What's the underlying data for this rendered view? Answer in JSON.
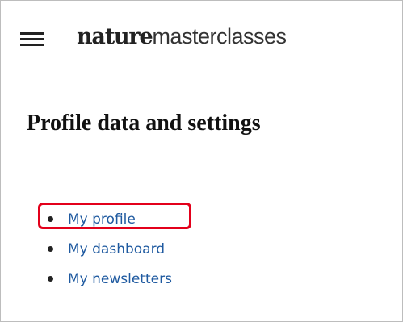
{
  "header": {
    "logo_primary": "nature",
    "logo_secondary": "masterclasses",
    "menu_icon": "hamburger-menu-icon"
  },
  "main": {
    "title": "Profile data and settings",
    "nav": [
      {
        "label": "My profile",
        "highlighted": true
      },
      {
        "label": "My dashboard",
        "highlighted": false
      },
      {
        "label": "My newsletters",
        "highlighted": false
      }
    ]
  },
  "colors": {
    "link": "#1f5aa0",
    "highlight": "#e3001b"
  }
}
